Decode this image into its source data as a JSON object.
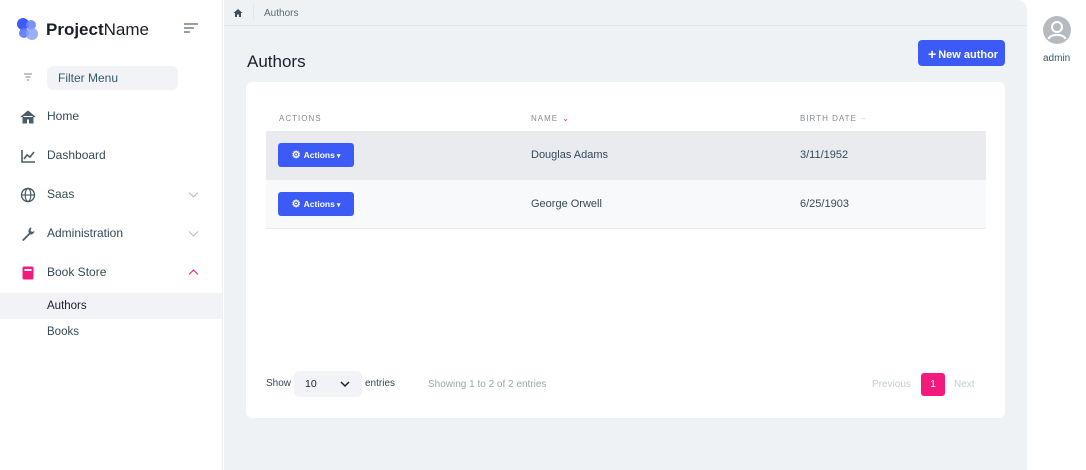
{
  "brand": {
    "name_bold": "Project",
    "name_rest": "Name",
    "accent": "#3c5bf6",
    "pink": "#f4197d"
  },
  "sidebar": {
    "filter_placeholder": "Filter Menu",
    "items": [
      {
        "label": "Home",
        "icon": "home-icon"
      },
      {
        "label": "Dashboard",
        "icon": "chart-line-icon"
      },
      {
        "label": "Saas",
        "icon": "globe-icon",
        "expandable": true
      },
      {
        "label": "Administration",
        "icon": "wrench-icon",
        "expandable": true
      },
      {
        "label": "Book Store",
        "icon": "book-icon",
        "expandable": true,
        "expanded": true
      }
    ],
    "sub_items": [
      {
        "label": "Authors",
        "current": true
      },
      {
        "label": "Books"
      }
    ]
  },
  "breadcrumb": {
    "current": "Authors"
  },
  "page": {
    "title": "Authors",
    "new_button": "New author"
  },
  "table": {
    "headers": {
      "actions": "ACTIONS",
      "name": "NAME",
      "birth_date": "BIRTH DATE"
    },
    "action_label": "Actions",
    "rows": [
      {
        "name": "Douglas Adams",
        "birth_date": "3/11/1952"
      },
      {
        "name": "George Orwell",
        "birth_date": "6/25/1903"
      }
    ]
  },
  "footer": {
    "show": "Show",
    "page_size": "10",
    "entries": "entries",
    "showing": "Showing 1 to 2 of 2 entries",
    "previous": "Previous",
    "current_page": "1",
    "next": "Next"
  },
  "user": {
    "name": "admin"
  }
}
